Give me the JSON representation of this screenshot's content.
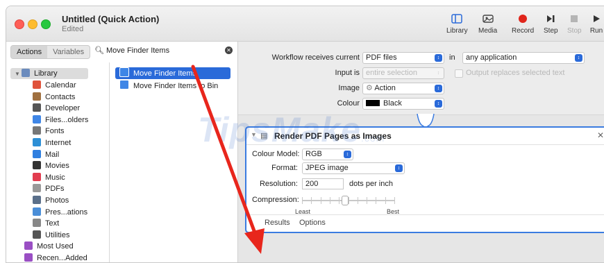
{
  "window": {
    "title": "Untitled (Quick Action)",
    "subtitle": "Edited"
  },
  "toolbar": {
    "library": "Library",
    "media": "Media",
    "record": "Record",
    "step": "Step",
    "stop": "Stop",
    "run": "Run"
  },
  "sidebar": {
    "tab_actions": "Actions",
    "tab_variables": "Variables",
    "search_value": "Move Finder Items",
    "library_root": "Library",
    "categories": [
      {
        "label": "Calendar",
        "color": "#e0533b",
        "icon": "calendar-icon"
      },
      {
        "label": "Contacts",
        "color": "#a07040",
        "icon": "contacts-icon"
      },
      {
        "label": "Developer",
        "color": "#555555",
        "icon": "developer-icon"
      },
      {
        "label": "Files...olders",
        "color": "#3f86e6",
        "icon": "finder-icon"
      },
      {
        "label": "Fonts",
        "color": "#777777",
        "icon": "fonts-icon"
      },
      {
        "label": "Internet",
        "color": "#2d8fd6",
        "icon": "internet-icon"
      },
      {
        "label": "Mail",
        "color": "#2f7fe0",
        "icon": "mail-icon"
      },
      {
        "label": "Movies",
        "color": "#333333",
        "icon": "movies-icon"
      },
      {
        "label": "Music",
        "color": "#e23c4f",
        "icon": "music-icon"
      },
      {
        "label": "PDFs",
        "color": "#999999",
        "icon": "pdf-icon"
      },
      {
        "label": "Photos",
        "color": "#5a6f8a",
        "icon": "photos-icon"
      },
      {
        "label": "Pres...ations",
        "color": "#4a8ed8",
        "icon": "presentations-icon"
      },
      {
        "label": "Text",
        "color": "#888888",
        "icon": "text-icon"
      },
      {
        "label": "Utilities",
        "color": "#555555",
        "icon": "utilities-icon"
      }
    ],
    "smart_groups": [
      {
        "label": "Most Used",
        "color": "#9a4fc4",
        "icon": "smart-folder-icon"
      },
      {
        "label": "Recen...Added",
        "color": "#9a4fc4",
        "icon": "smart-folder-icon"
      }
    ],
    "results": [
      "Move Finder Items",
      "Move Finder Items to Bin"
    ]
  },
  "workflow": {
    "receives_label": "Workflow receives current",
    "receives_value": "PDF files",
    "in_label": "in",
    "in_value": "any application",
    "input_is_label": "Input is",
    "input_is_value": "entire selection",
    "output_replaces_label": "Output replaces selected text",
    "image_label": "Image",
    "image_value": "Action",
    "colour_label": "Colour",
    "colour_value": "Black"
  },
  "action": {
    "title": "Render PDF Pages as Images",
    "colour_model_label": "Colour Model:",
    "colour_model_value": "RGB",
    "format_label": "Format:",
    "format_value": "JPEG image",
    "resolution_label": "Resolution:",
    "resolution_value": "200",
    "resolution_unit": "dots per inch",
    "compression_label": "Compression:",
    "compression_min": "Least",
    "compression_max": "Best",
    "compression_level": 0.45,
    "tab_results": "Results",
    "tab_options": "Options"
  },
  "watermark": {
    "text": "TipsMake",
    "suffix": ".com"
  },
  "colors": {
    "accent": "#2a6ad9",
    "arrow": "#e8261c"
  }
}
